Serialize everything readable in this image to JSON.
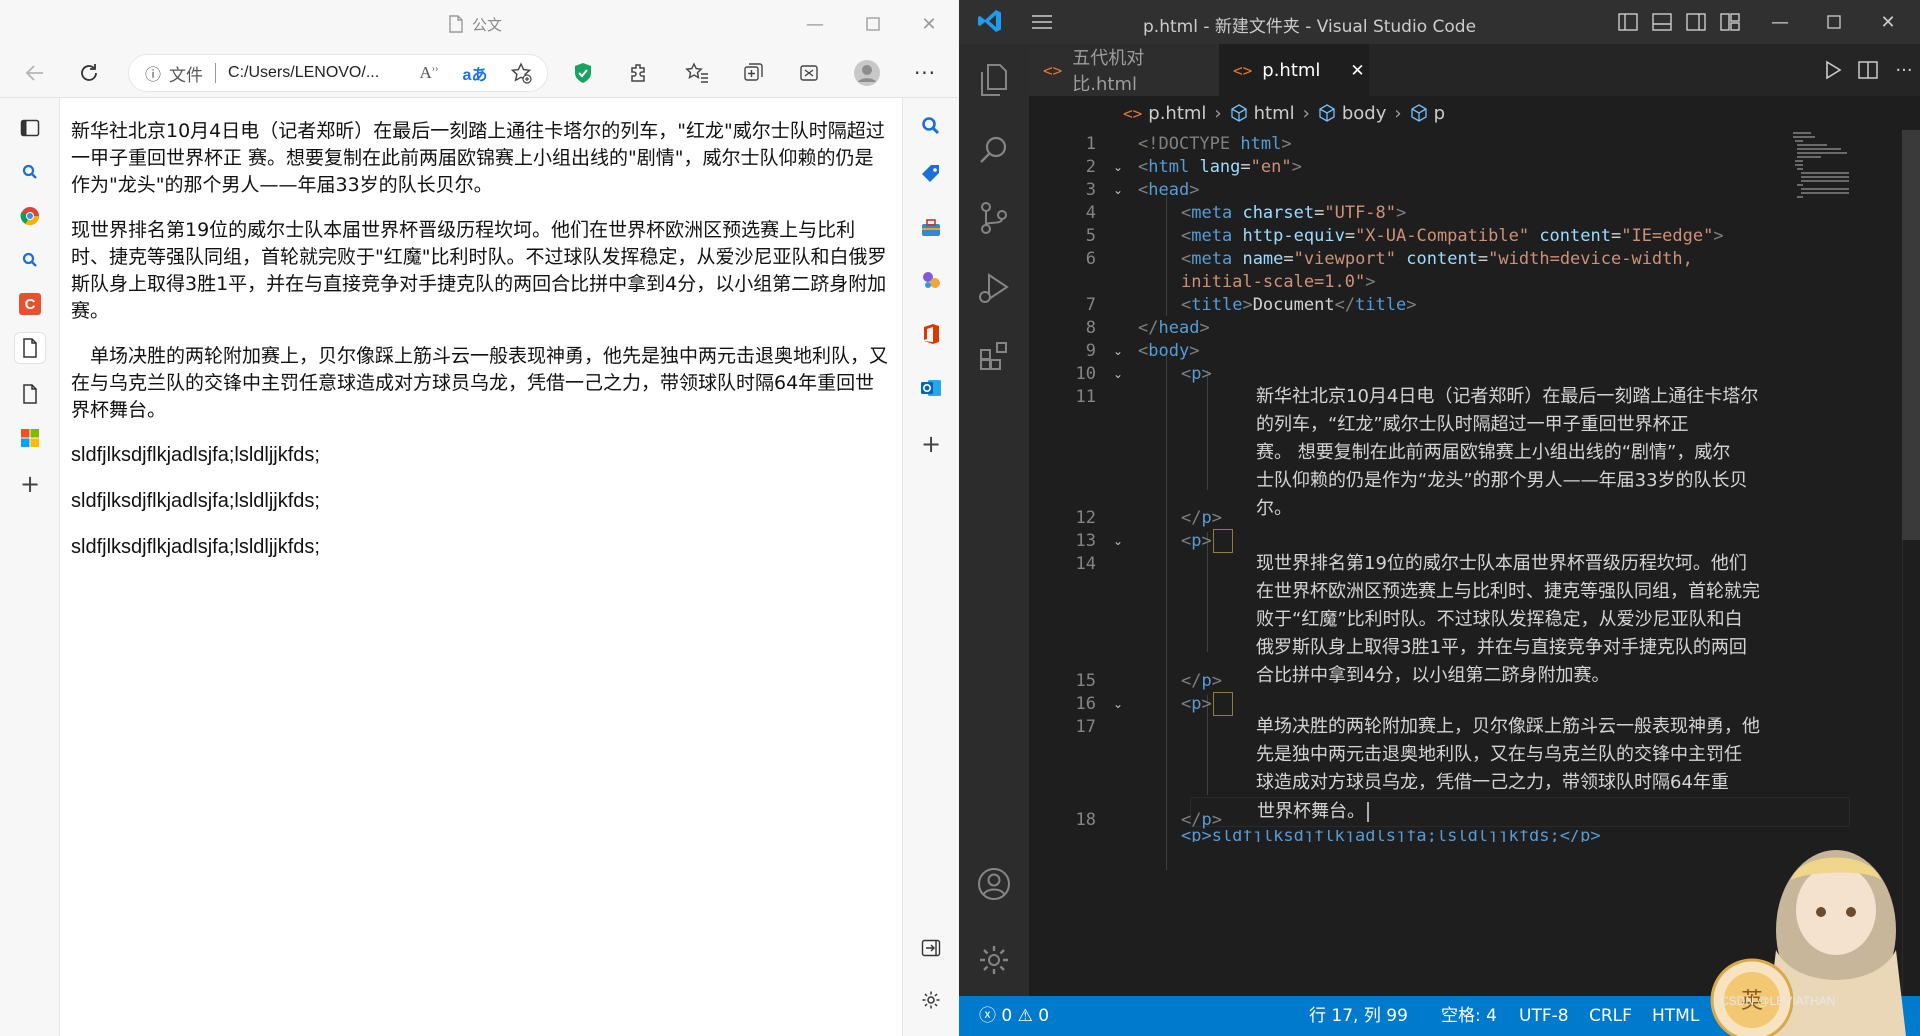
{
  "browser": {
    "tab_title": "公文",
    "address": {
      "label": "文件",
      "url": "C:/Users/LENOVO/..."
    },
    "paragraphs": [
      "新华社北京10月4日电（记者郑昕）在最后一刻踏上通往卡塔尔的列车，\"红龙\"威尔士队时隔超过一甲子重回世界杯正 赛。想要复制在此前两届欧锦赛上小组出线的\"剧情\"，威尔士队仰赖的仍是作为\"龙头\"的那个男人——年届33岁的队长贝尔。",
      "现世界排名第19位的威尔士队本届世界杯晋级历程坎坷。他们在世界杯欧洲区预选赛上与比利时、捷克等强队同组，首轮就完败于\"红魔\"比利时队。不过球队发挥稳定，从爱沙尼亚队和白俄罗斯队身上取得3胜1平，并在与直接竞争对手捷克队的两回合比拼中拿到4分，以小组第二跻身附加赛。",
      "　单场决胜的两轮附加赛上，贝尔像踩上筋斗云一般表现神勇，他先是独中两元击退奥地利队，又在与乌克兰队的交锋中主罚任意球造成对方球员乌龙，凭借一己之力，带领球队时隔64年重回世界杯舞台。"
    ],
    "latin_lines": [
      "sldfjlksdjflkjadlsjfa;lsldljjkfds;",
      "sldfjlksdjflkjadlsjfa;lsldljjkfds;",
      "sldfjlksdjflkjadlsjfa;lsldljjkfds;"
    ]
  },
  "vscode": {
    "window_title": "p.html - 新建文件夹 - Visual Studio Code",
    "tabs": [
      {
        "label": "五代机对比.html",
        "active": false
      },
      {
        "label": "p.html",
        "active": true
      }
    ],
    "breadcrumb": [
      "p.html",
      "html",
      "body",
      "p"
    ],
    "code": {
      "doctype": "<!DOCTYPE ",
      "doctype_kw": "html",
      "html_open": "html",
      "lang_attr": "lang",
      "lang_val": "\"en\"",
      "head": "head",
      "meta": "meta",
      "charset_attr": "charset",
      "charset_val": "\"UTF-8\"",
      "httpequiv_attr": "http-equiv",
      "httpequiv_val": "\"X-UA-Compatible\"",
      "content_attr": "content",
      "ie_val": "\"IE=edge\"",
      "name_attr": "name",
      "viewport_val": "\"viewport\"",
      "viewport_content_1": "\"width=device-width,",
      "viewport_content_2": "initial-scale=1.0\"",
      "title_tag": "title",
      "title_text": "Document",
      "body": "body",
      "p": "p",
      "p1_lines": [
        "新华社北京10月4日电（记者郑昕）在最后一刻踏上通往卡塔尔",
        "的列车，“红龙”威尔士队时隔超过一甲子重回世界杯正",
        "赛。  想要复制在此前两届欧锦赛上小组出线的“剧情”，威尔",
        "士队仰赖的仍是作为“龙头”的那个男人——年届33岁的队长贝",
        "尔。"
      ],
      "p2_lines": [
        "现世界排名第19位的威尔士队本届世界杯晋级历程坎坷。他们",
        "在世界杯欧洲区预选赛上与比利时、捷克等强队同组，首轮就完",
        "败于“红魔”比利时队。不过球队发挥稳定，从爱沙尼亚队和白",
        "俄罗斯队身上取得3胜1平，并在与直接竞争对手捷克队的两回",
        "合比拼中拿到4分，以小组第二跻身附加赛。"
      ],
      "p3_lines": [
        "单场决胜的两轮附加赛上，贝尔像踩上筋斗云一般表现神勇，他",
        "先是独中两元击退奥地利队，又在与乌克兰队的交锋中主罚任",
        "球造成对方球员乌龙，凭借一己之力，带领球队时隔64年重",
        "世界杯舞台。"
      ],
      "last_line_partial": "<p>sldfjlksdjflkjadlsjfa;lsldljjkfds;</p>"
    },
    "line_numbers": [
      "1",
      "2",
      "3",
      "4",
      "5",
      "6",
      "7",
      "8",
      "9",
      "10",
      "11",
      "12",
      "13",
      "14",
      "15",
      "16",
      "17",
      "18"
    ],
    "status": {
      "errors": "0",
      "warnings": "0",
      "position": "行 17, 列 99",
      "spaces": "空格: 4",
      "encoding": "UTF-8",
      "eol": "CRLF",
      "language": "HTML"
    },
    "watermark": "CSDN @LEVIATHAN"
  },
  "colors": {
    "vscode_blue": "#007acc",
    "edge_accent": "#0078d4"
  }
}
